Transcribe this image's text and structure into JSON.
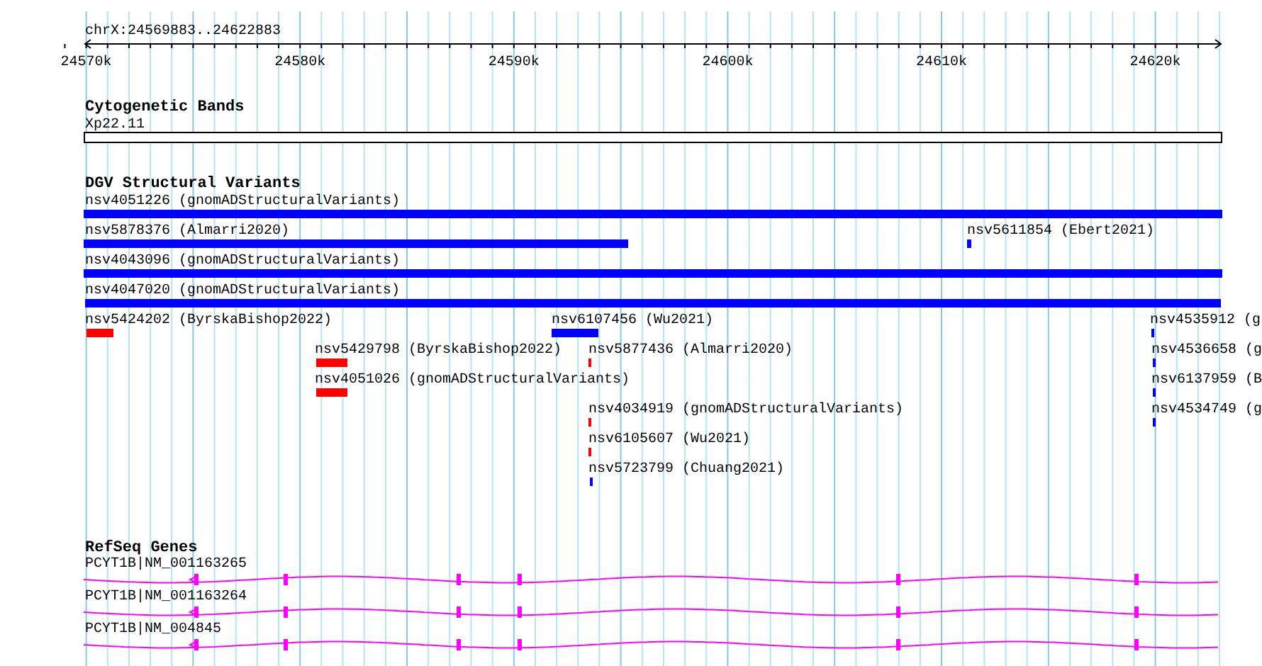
{
  "ruler": {
    "location": "chrX:24569883..24622883",
    "ticks": [
      "24570k",
      "24580k",
      "24590k",
      "24600k",
      "24610k",
      "24620k"
    ]
  },
  "tracks": [
    {
      "kind": "bands",
      "title": "Cytogenetic Bands",
      "bands": [
        {
          "label": "Xp22.11"
        }
      ]
    },
    {
      "kind": "variants",
      "title": "DGV Structural Variants",
      "features": [
        {
          "label": "nsv4051226 (gnomADStructuralVariants)",
          "color": "#0000ff"
        },
        {
          "label": "nsv5878376 (Almarri2020)",
          "color": "#0000ff"
        },
        {
          "label": "nsv5611854 (Ebert2021)",
          "color": "#0000ff"
        },
        {
          "label": "nsv4043096 (gnomADStructuralVariants)",
          "color": "#0000ff"
        },
        {
          "label": "nsv4047020 (gnomADStructuralVariants)",
          "color": "#0000ff"
        },
        {
          "label": "nsv5424202 (ByrskaBishop2022)",
          "color": "#ff0000"
        },
        {
          "label": "nsv6107456 (Wu2021)",
          "color": "#0000ff"
        },
        {
          "label": "nsv4535912 (g",
          "color": "#0000ff"
        },
        {
          "label": "nsv5429798 (ByrskaBishop2022)",
          "color": "#ff0000"
        },
        {
          "label": "nsv5877436 (Almarri2020)",
          "color": "#ff0000"
        },
        {
          "label": "nsv4536658 (g",
          "color": "#0000ff"
        },
        {
          "label": "nsv4051026 (gnomADStructuralVariants)",
          "color": "#ff0000"
        },
        {
          "label": "nsv6137959 (B",
          "color": "#0000ff"
        },
        {
          "label": "nsv4034919 (gnomADStructuralVariants)",
          "color": "#ff0000"
        },
        {
          "label": "nsv4534749 (g",
          "color": "#0000ff"
        },
        {
          "label": "nsv6105607 (Wu2021)",
          "color": "#ff0000"
        },
        {
          "label": "nsv5723799 (Chuang2021)",
          "color": "#0000ff"
        }
      ]
    },
    {
      "kind": "genes",
      "title": "RefSeq Genes",
      "transcripts": [
        {
          "label": "PCYT1B|NM_001163265"
        },
        {
          "label": "PCYT1B|NM_001163264"
        },
        {
          "label": "PCYT1B|NM_004845"
        }
      ]
    }
  ]
}
